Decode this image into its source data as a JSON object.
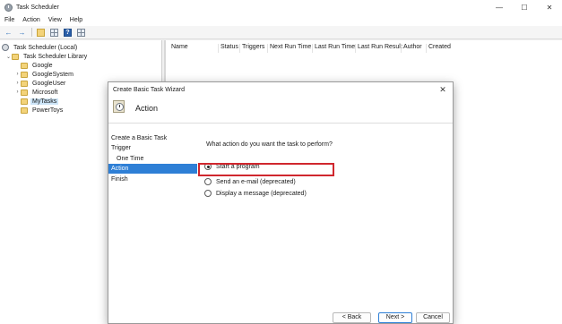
{
  "app": {
    "title": "Task Scheduler",
    "controls": {
      "minimize": "—",
      "maximize": "☐",
      "close": "✕"
    }
  },
  "menu": [
    "File",
    "Action",
    "View",
    "Help"
  ],
  "toolbar": {
    "back_icon": "back-arrow-icon",
    "forward_icon": "forward-arrow-icon"
  },
  "tree": {
    "root": "Task Scheduler (Local)",
    "library": "Task Scheduler Library",
    "children": [
      "Google",
      "GoogleSystem",
      "GoogleUser",
      "Microsoft",
      "MyTasks",
      "PowerToys"
    ],
    "selected": "MyTasks"
  },
  "list": {
    "columns": [
      "Name",
      "Status",
      "Triggers",
      "Next Run Time",
      "Last Run Time",
      "Last Run Result",
      "Author",
      "Created"
    ]
  },
  "dialog": {
    "title": "Create Basic Task Wizard",
    "close": "✕",
    "heading": "Action",
    "nav": [
      "Create a Basic Task",
      "Trigger",
      "One Time",
      "Action",
      "Finish"
    ],
    "active_step": "Action",
    "question": "What action do you want the task to perform?",
    "options": [
      "Start a program",
      "Send an e-mail (deprecated)",
      "Display a message (deprecated)"
    ],
    "selected_option": "Start a program",
    "buttons": {
      "back": "< Back",
      "next": "Next >",
      "cancel": "Cancel"
    }
  },
  "colors": {
    "highlight": "#d0272e",
    "nav_active": "#2e7fd6",
    "tree_selected": "#cce4f7"
  }
}
